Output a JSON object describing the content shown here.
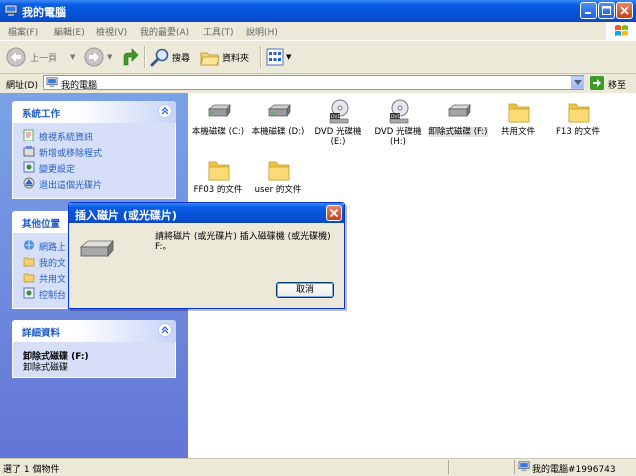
{
  "window": {
    "title": "我的電腦"
  },
  "menu": [
    "檔案(F)",
    "編輯(E)",
    "檢視(V)",
    "我的最愛(A)",
    "工具(T)",
    "說明(H)"
  ],
  "toolbar": {
    "back": "上一頁",
    "search": "搜尋",
    "folders": "資料夾"
  },
  "address": {
    "label": "網址(D)",
    "value": "我的電腦",
    "go": "移至"
  },
  "panels": {
    "system": {
      "title": "系統工作",
      "tasks": [
        "檢視系統資訊",
        "新增或移除程式",
        "變更設定",
        "退出這個光碟片"
      ]
    },
    "other": {
      "title": "其他位置",
      "tasks": [
        "網路上",
        "我的文",
        "共用文",
        "控制台"
      ]
    },
    "details": {
      "title": "詳細資料",
      "name": "卸除式磁碟 (F:)",
      "type": "卸除式磁碟"
    }
  },
  "items": [
    {
      "label": "本機磁碟 (C:)",
      "icon": "hard-drive-icon"
    },
    {
      "label": "本機磁碟 (D:)",
      "icon": "hard-drive-icon"
    },
    {
      "label": "DVD 光碟機 (E:)",
      "icon": "dvd-drive-icon"
    },
    {
      "label": "DVD 光碟機 (H:)",
      "icon": "dvd-drive-icon"
    },
    {
      "label": "卸除式磁碟 (F:)",
      "icon": "removable-disk-icon"
    },
    {
      "label": "共用文件",
      "icon": "folder-icon"
    },
    {
      "label": "F13 的文件",
      "icon": "folder-icon"
    },
    {
      "label": "FF03 的文件",
      "icon": "folder-icon"
    },
    {
      "label": "user 的文件",
      "icon": "folder-icon"
    }
  ],
  "status": {
    "left": "選了 1 個物件",
    "right": "我的電腦#1996743"
  },
  "dialog": {
    "title": "插入磁片 (或光碟片)",
    "message": "請將磁片 (或光碟片) 插入磁碟機 (或光碟機) F:。",
    "cancel": "取消"
  },
  "colors": {
    "titlebar": "#0a5fe6",
    "link": "#215dc6",
    "pane": "#7ba2e7"
  }
}
